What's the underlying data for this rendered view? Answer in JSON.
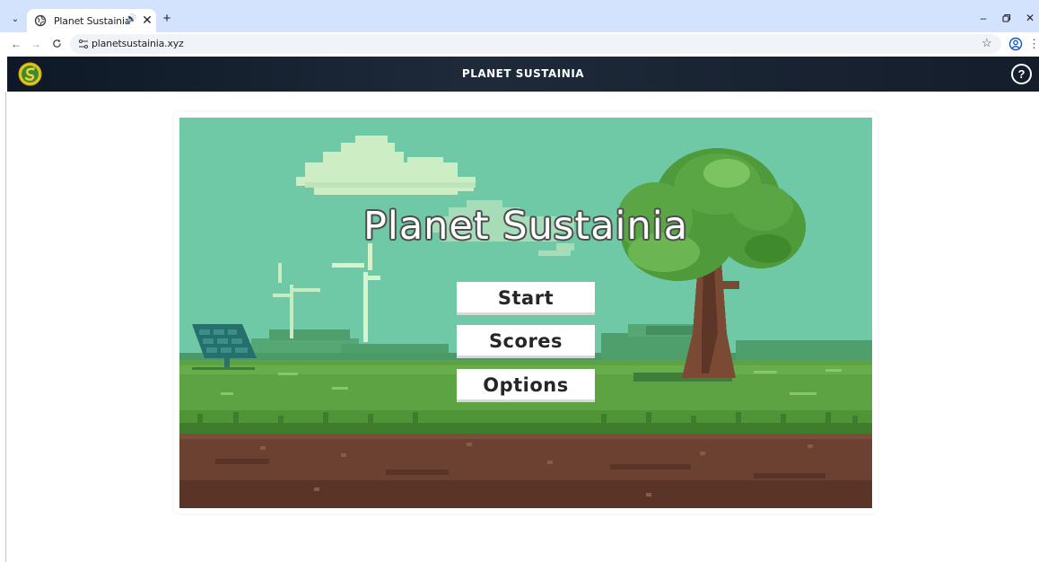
{
  "browser": {
    "tab_title": "Planet Sustainia",
    "url": "planetsustainia.xyz",
    "tab_close": "✕",
    "new_tab": "+",
    "tab_audio": "🔊"
  },
  "header": {
    "title": "PLANET SUSTAINIA",
    "help_label": "?"
  },
  "game": {
    "title": "Planet Sustainia",
    "menu": [
      {
        "label": "Start"
      },
      {
        "label": "Scores"
      },
      {
        "label": "Options"
      }
    ]
  },
  "colors": {
    "sky": "#6fc9a6",
    "grass": "#5da243",
    "soil": "#6b4232",
    "header_bg": "#141d2b"
  }
}
